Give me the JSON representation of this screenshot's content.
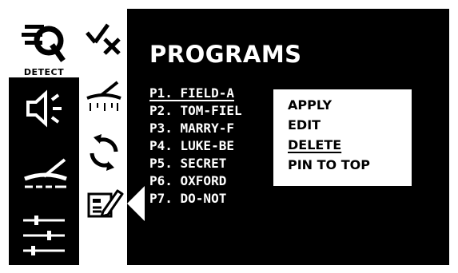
{
  "sidebar": {
    "detect_label": "DETECT",
    "main_icons": [
      "detect-icon",
      "speaker-icon",
      "metal-detector-icon",
      "sliders-icon"
    ],
    "sub_icons": [
      "check-x-icon",
      "detector-sweep-icon",
      "refresh-icon",
      "edit-icon"
    ]
  },
  "main": {
    "title": "PROGRAMS",
    "programs": [
      {
        "label": "P1. FIELD-A"
      },
      {
        "label": "P2. TOM-FIEL"
      },
      {
        "label": "P3. MARRY-F"
      },
      {
        "label": "P4. LUKE-BE"
      },
      {
        "label": "P5. SECRET"
      },
      {
        "label": "P6. OXFORD"
      },
      {
        "label": "P7. DO-NOT"
      }
    ],
    "selected_program": "P1. FIELD-A"
  },
  "context_menu": {
    "items": [
      {
        "label": "APPLY"
      },
      {
        "label": "EDIT"
      },
      {
        "label": "DELETE"
      },
      {
        "label": "PIN TO TOP"
      }
    ],
    "highlighted": "DELETE"
  },
  "colors": {
    "background": "#000000",
    "foreground": "#ffffff"
  }
}
